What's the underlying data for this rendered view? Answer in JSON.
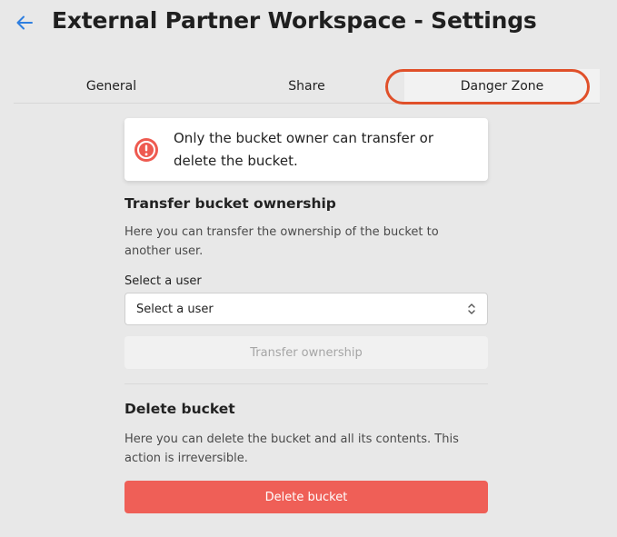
{
  "header": {
    "title": "External Partner Workspace - Settings",
    "back_icon": "arrow-left-icon"
  },
  "tabs": [
    {
      "label": "General",
      "active": false
    },
    {
      "label": "Share",
      "active": false
    },
    {
      "label": "Danger Zone",
      "active": true
    }
  ],
  "alert": {
    "icon": "exclamation-circle-icon",
    "text": "Only the bucket owner can transfer or delete the bucket."
  },
  "transfer": {
    "title": "Transfer bucket ownership",
    "description": "Here you can transfer the ownership of the bucket to another user.",
    "select_label": "Select a user",
    "select_value": "Select a user",
    "button_label": "Transfer ownership"
  },
  "delete": {
    "title": "Delete bucket",
    "description": "Here you can delete the bucket and all its contents. This action is irreversible.",
    "button_label": "Delete bucket"
  },
  "colors": {
    "accent": "#2f7fe0",
    "danger": "#ef5f57",
    "highlight_ring": "#e0502a"
  }
}
